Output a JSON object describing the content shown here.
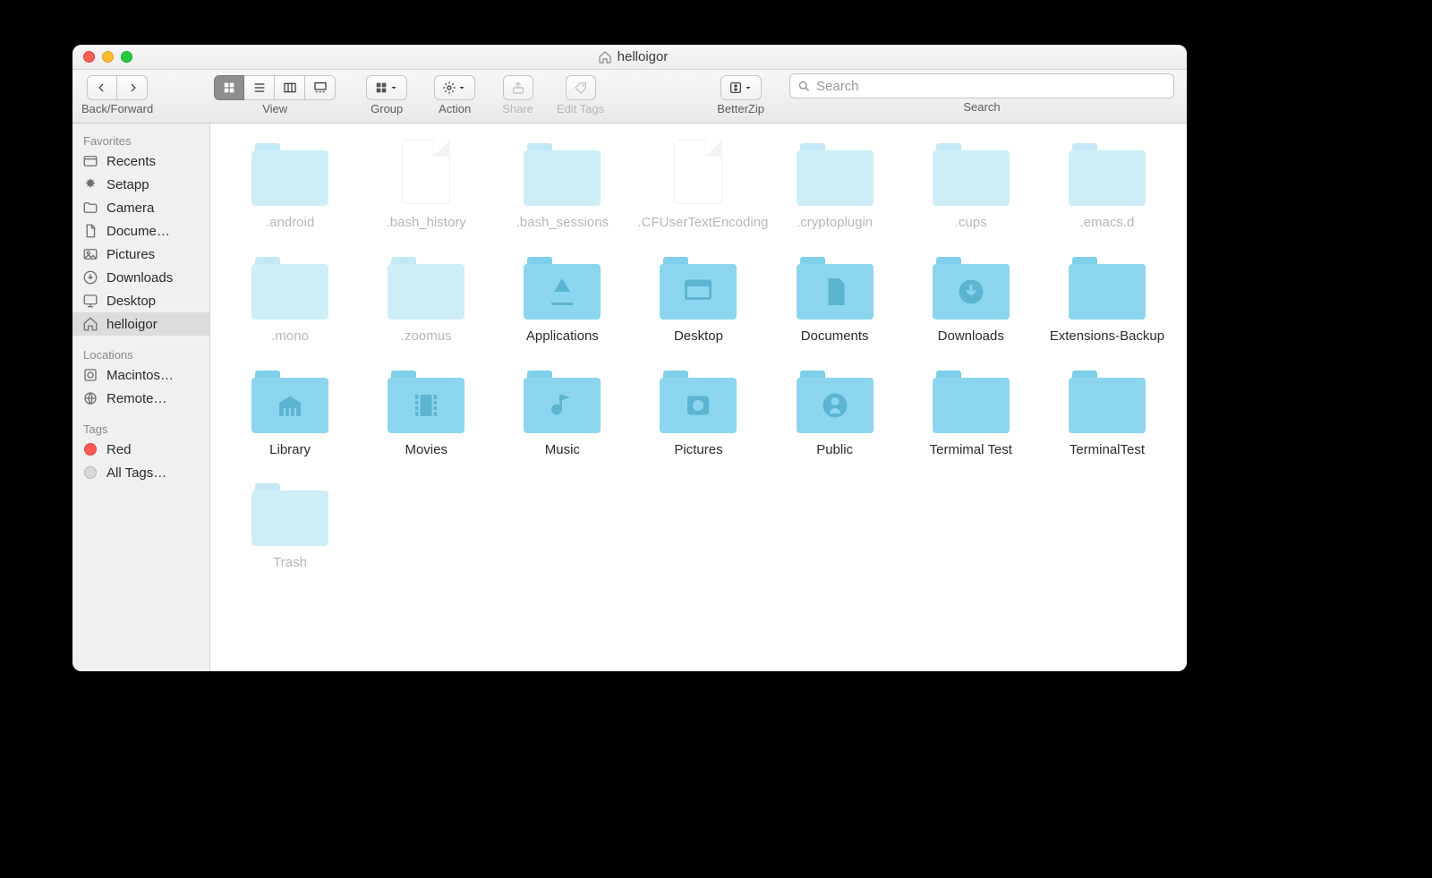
{
  "window": {
    "title": "helloigor"
  },
  "toolbar": {
    "back_forward_label": "Back/Forward",
    "view_label": "View",
    "group_label": "Group",
    "action_label": "Action",
    "share_label": "Share",
    "edit_tags_label": "Edit Tags",
    "betterzip_label": "BetterZip",
    "search_label": "Search",
    "search_placeholder": "Search"
  },
  "sidebar": {
    "favorites_header": "Favorites",
    "favorites": [
      {
        "icon": "recents",
        "label": "Recents"
      },
      {
        "icon": "setapp",
        "label": "Setapp"
      },
      {
        "icon": "folder",
        "label": "Camera"
      },
      {
        "icon": "documents",
        "label": "Docume…"
      },
      {
        "icon": "pictures",
        "label": "Pictures"
      },
      {
        "icon": "downloads",
        "label": "Downloads"
      },
      {
        "icon": "desktop",
        "label": "Desktop"
      },
      {
        "icon": "home",
        "label": "helloigor",
        "selected": true
      }
    ],
    "locations_header": "Locations",
    "locations": [
      {
        "icon": "disk",
        "label": "Macintos…"
      },
      {
        "icon": "remote",
        "label": "Remote…"
      }
    ],
    "tags_header": "Tags",
    "tags": [
      {
        "color": "#ff5a52",
        "label": "Red"
      },
      {
        "color": "#d9d9d9",
        "label": "All Tags…"
      }
    ]
  },
  "items": [
    {
      "name": ".android",
      "type": "folder",
      "hidden": true
    },
    {
      "name": ".bash_history",
      "type": "document",
      "hidden": true
    },
    {
      "name": ".bash_sessions",
      "type": "folder",
      "hidden": true
    },
    {
      "name": ".CFUserTextEncoding",
      "type": "document",
      "hidden": true
    },
    {
      "name": ".cryptoplugin",
      "type": "folder",
      "hidden": true
    },
    {
      "name": ".cups",
      "type": "folder",
      "hidden": true
    },
    {
      "name": ".emacs.d",
      "type": "folder",
      "hidden": true
    },
    {
      "name": ".mono",
      "type": "folder",
      "hidden": true
    },
    {
      "name": ".zoomus",
      "type": "folder",
      "hidden": true
    },
    {
      "name": "Applications",
      "type": "folder",
      "glyph": "apps"
    },
    {
      "name": "Desktop",
      "type": "folder",
      "glyph": "desktop"
    },
    {
      "name": "Documents",
      "type": "folder",
      "glyph": "documents"
    },
    {
      "name": "Downloads",
      "type": "folder",
      "glyph": "downloads"
    },
    {
      "name": "Extensions-Backup",
      "type": "folder"
    },
    {
      "name": "Library",
      "type": "folder",
      "glyph": "library"
    },
    {
      "name": "Movies",
      "type": "folder",
      "glyph": "movies"
    },
    {
      "name": "Music",
      "type": "folder",
      "glyph": "music"
    },
    {
      "name": "Pictures",
      "type": "folder",
      "glyph": "pictures"
    },
    {
      "name": "Public",
      "type": "folder",
      "glyph": "public"
    },
    {
      "name": "Termimal Test",
      "type": "folder"
    },
    {
      "name": "TerminalTest",
      "type": "folder"
    },
    {
      "name": "Trash",
      "type": "folder",
      "hidden": true
    }
  ]
}
